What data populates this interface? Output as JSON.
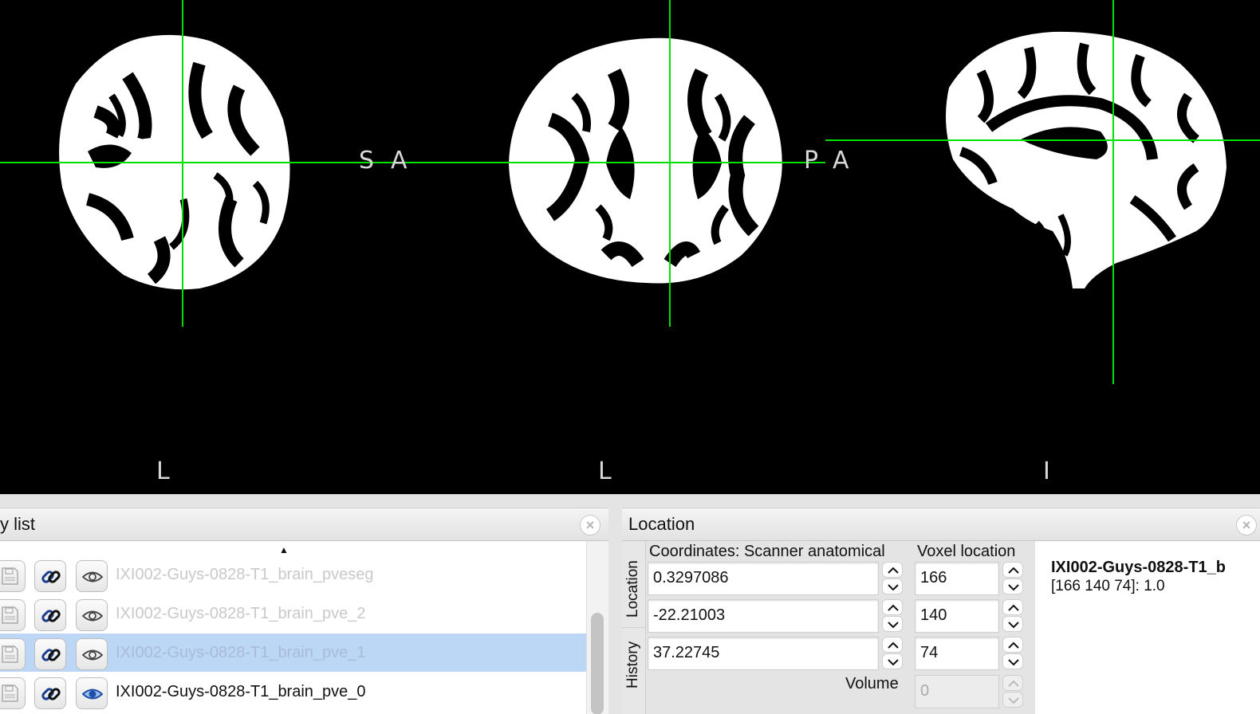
{
  "viewer": {
    "crosshair_color": "#00e000",
    "views": [
      {
        "name": "coronal",
        "labels": {
          "right": "S",
          "bottom": "L"
        }
      },
      {
        "name": "axial",
        "labels": {
          "left": "A",
          "right": "P",
          "bottom": "L"
        }
      },
      {
        "name": "sagittal",
        "labels": {
          "left": "A",
          "bottom": "I"
        }
      }
    ]
  },
  "overlay_panel": {
    "title": "y list",
    "close_glyph": "×",
    "scroll_up_glyph": "▲",
    "layers": [
      {
        "name": "IXI002-Guys-0828-T1_brain_pveseg",
        "visible": false,
        "selected": false
      },
      {
        "name": "IXI002-Guys-0828-T1_brain_pve_2",
        "visible": false,
        "selected": false
      },
      {
        "name": "IXI002-Guys-0828-T1_brain_pve_1",
        "visible": false,
        "selected": true
      },
      {
        "name": "IXI002-Guys-0828-T1_brain_pve_0",
        "visible": true,
        "selected": false
      }
    ]
  },
  "location_panel": {
    "title": "Location",
    "tabs": {
      "location": "Location",
      "history": "History"
    },
    "coords_label": "Coordinates: Scanner anatomical",
    "voxel_label": "Voxel location",
    "coords": [
      "0.3297086",
      "-22.21003",
      "37.22745"
    ],
    "voxels": [
      "166",
      "140",
      "74"
    ],
    "volume_label": "Volume",
    "volume_value": "0",
    "info_name": "IXI002-Guys-0828-T1_b",
    "info_value": "[166 140 74]: 1.0"
  }
}
